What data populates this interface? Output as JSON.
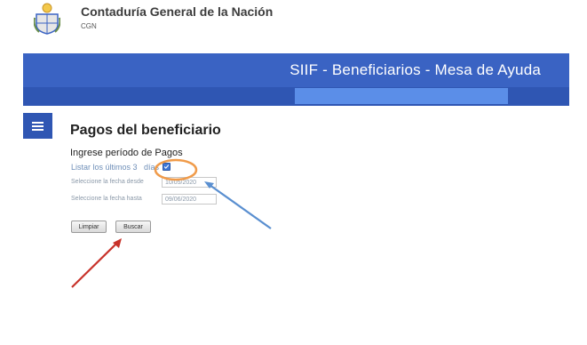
{
  "header": {
    "org_name": "Contaduría General de la Nación",
    "org_abbr": "CGN"
  },
  "banner": {
    "title": "SIIF - Beneficiarios - Mesa de Ayuda"
  },
  "main": {
    "title": "Pagos del beneficiario",
    "section_label": "Ingrese período de Pagos",
    "checkbox": {
      "label_pre": "Listar los últimos 3",
      "label_post": "días",
      "checked": true
    },
    "from": {
      "label": "Seleccione la fecha desde",
      "value": "10/05/2020"
    },
    "to": {
      "label": "Seleccione la fecha hasta",
      "value": "09/06/2020"
    },
    "buttons": {
      "clear": "Limpiar",
      "search": "Buscar"
    }
  },
  "annotations": {
    "circle_color": "#f09b4a",
    "blue_arrow_color": "#5a8fd0",
    "red_arrow_color": "#c8322a"
  },
  "colors": {
    "banner": "#3a63c3",
    "subbar": "#2f56b3",
    "field": "#5b8ee8"
  }
}
